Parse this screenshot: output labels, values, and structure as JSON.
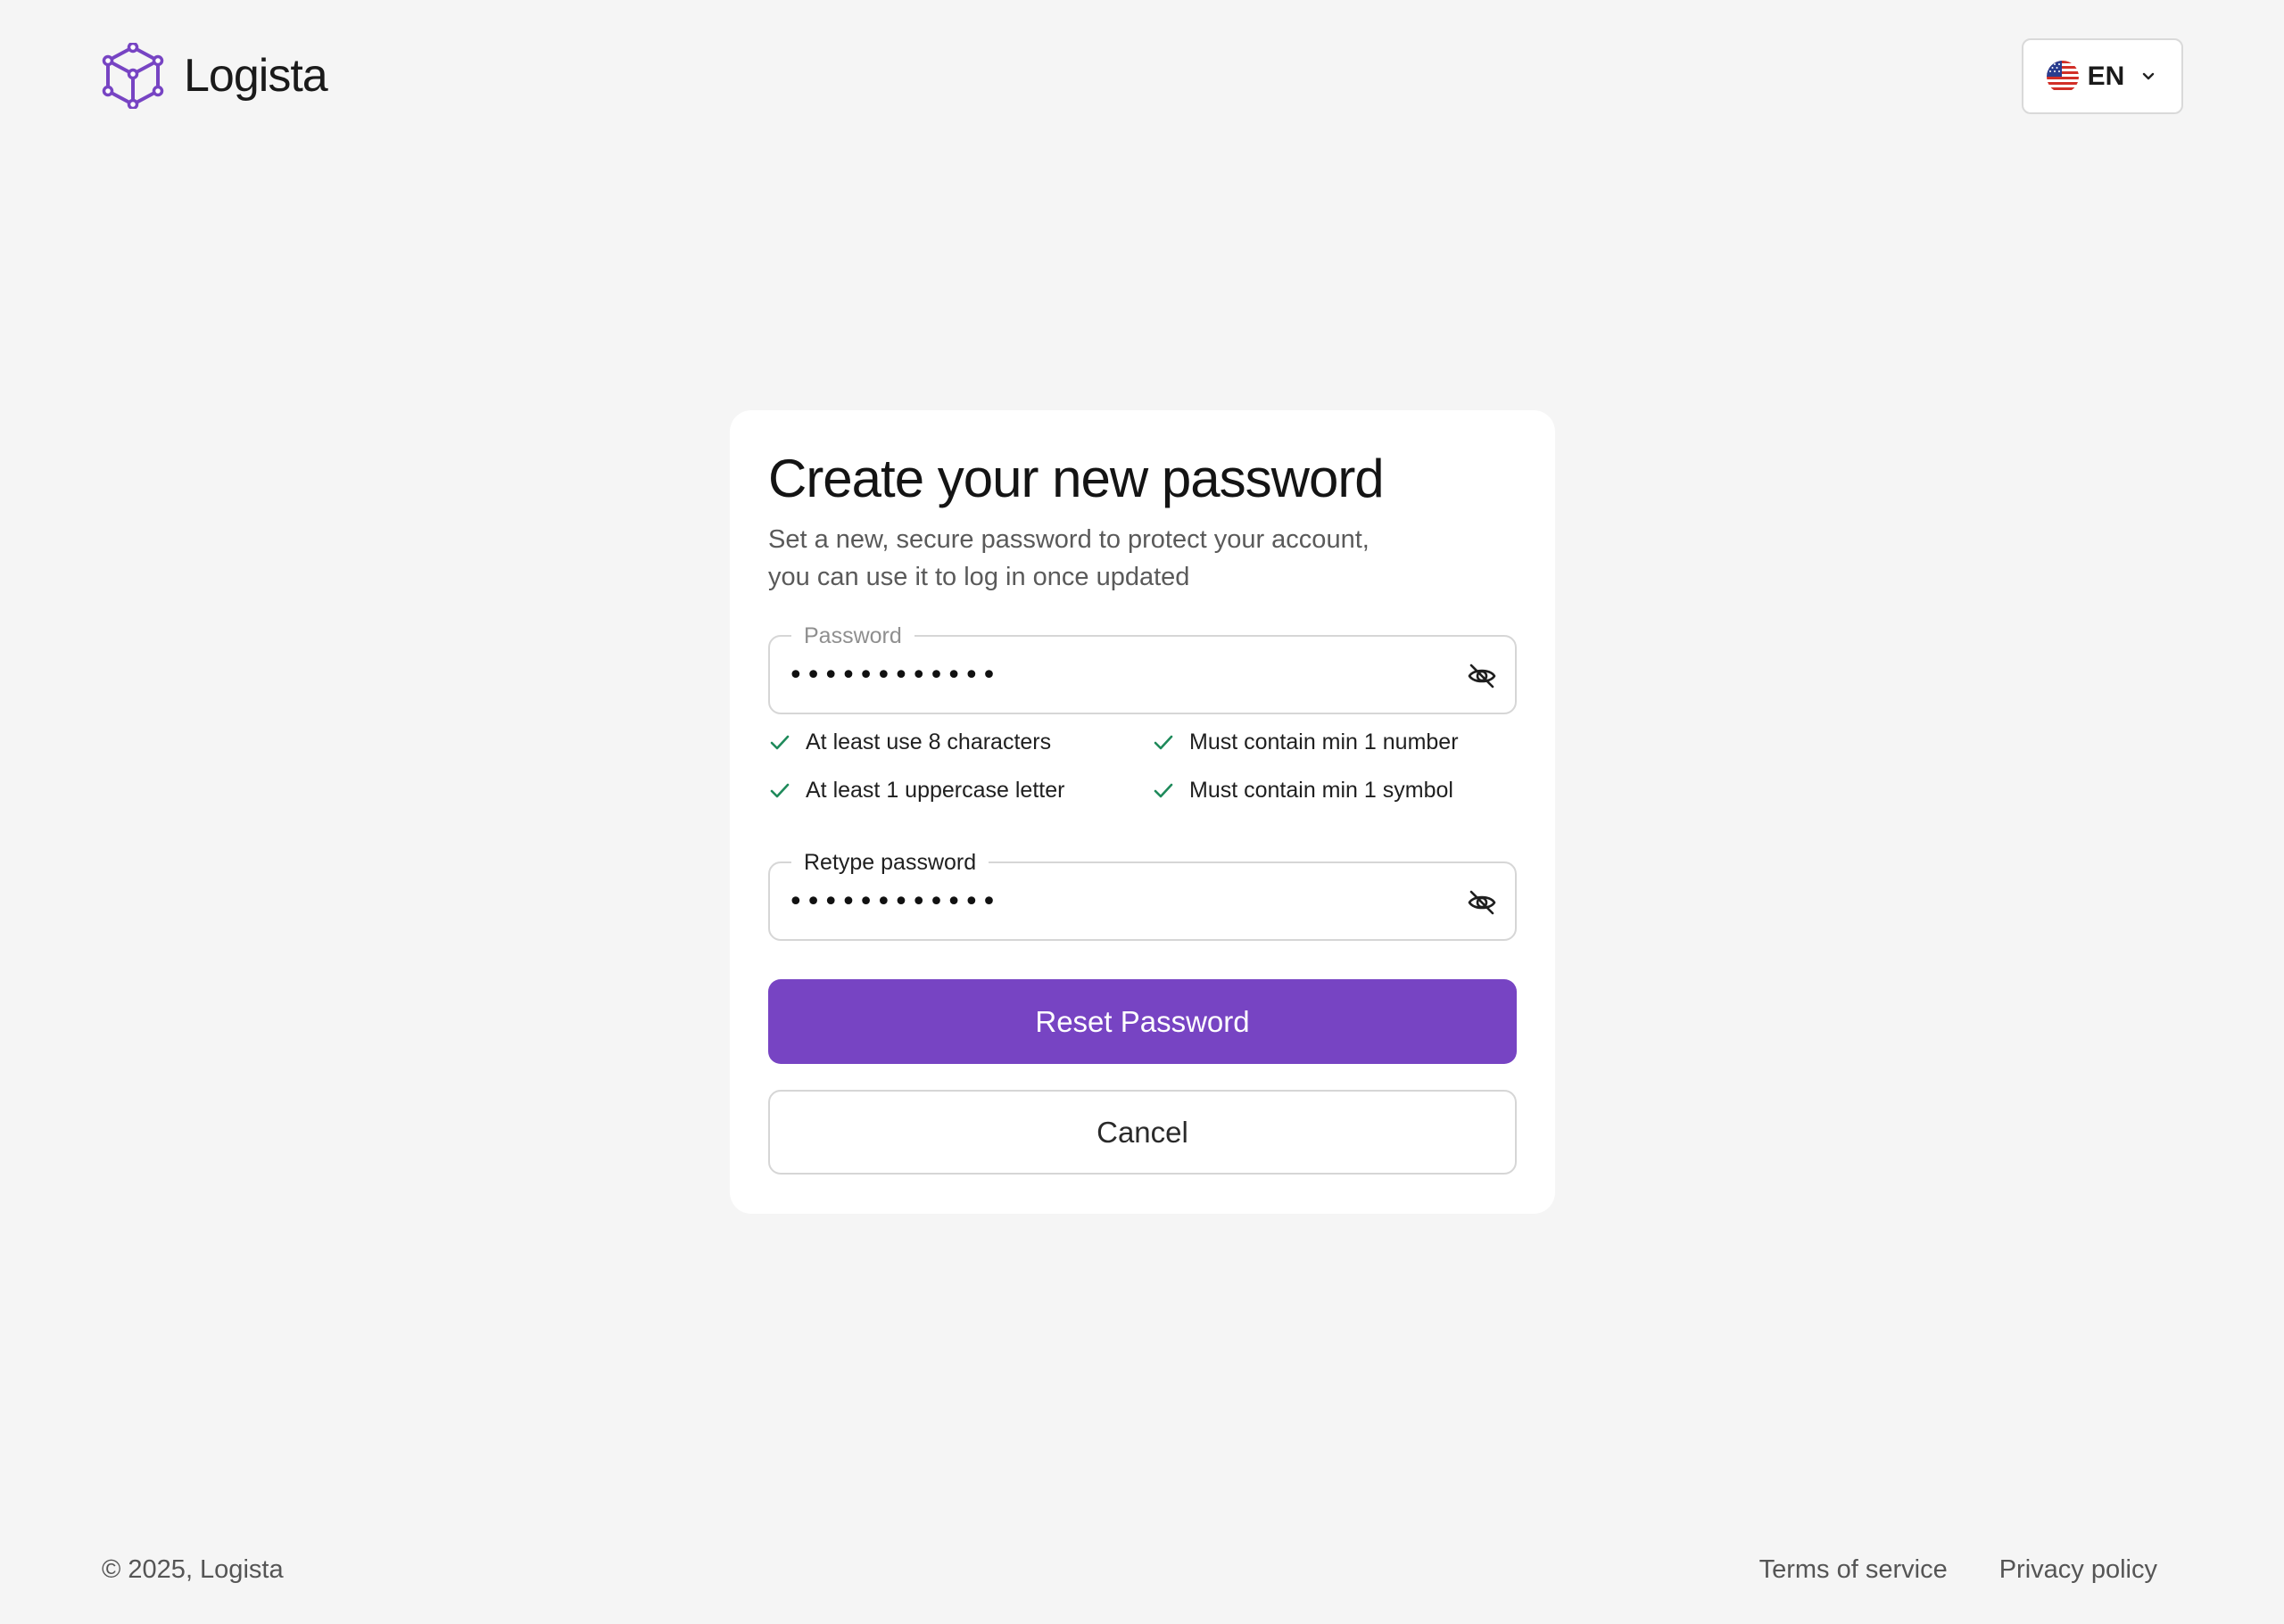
{
  "header": {
    "brand_name": "Logista",
    "logo_icon": "cube-network-icon",
    "language": {
      "code": "EN",
      "flag_icon": "us-flag-icon"
    }
  },
  "colors": {
    "accent": "#7744c3",
    "check": "#1f8a5b",
    "background": "#f5f5f5"
  },
  "card": {
    "title": "Create your new password",
    "subtitle_line1": "Set a new, secure password to protect your account,",
    "subtitle_line2": "you can use it to log in once updated",
    "password": {
      "label": "Password",
      "value": "••••••••••••"
    },
    "rules": [
      {
        "text": "At least use 8 characters",
        "met": true
      },
      {
        "text": "Must contain min 1 number",
        "met": true
      },
      {
        "text": "At least 1 uppercase letter",
        "met": true
      },
      {
        "text": "Must contain min 1 symbol",
        "met": true
      }
    ],
    "retype": {
      "label": "Retype password",
      "value": "••••••••••••"
    },
    "primary_button": "Reset Password",
    "secondary_button": "Cancel"
  },
  "footer": {
    "copyright": "© 2025, Logista",
    "links": [
      "Terms of service",
      "Privacy policy"
    ]
  }
}
